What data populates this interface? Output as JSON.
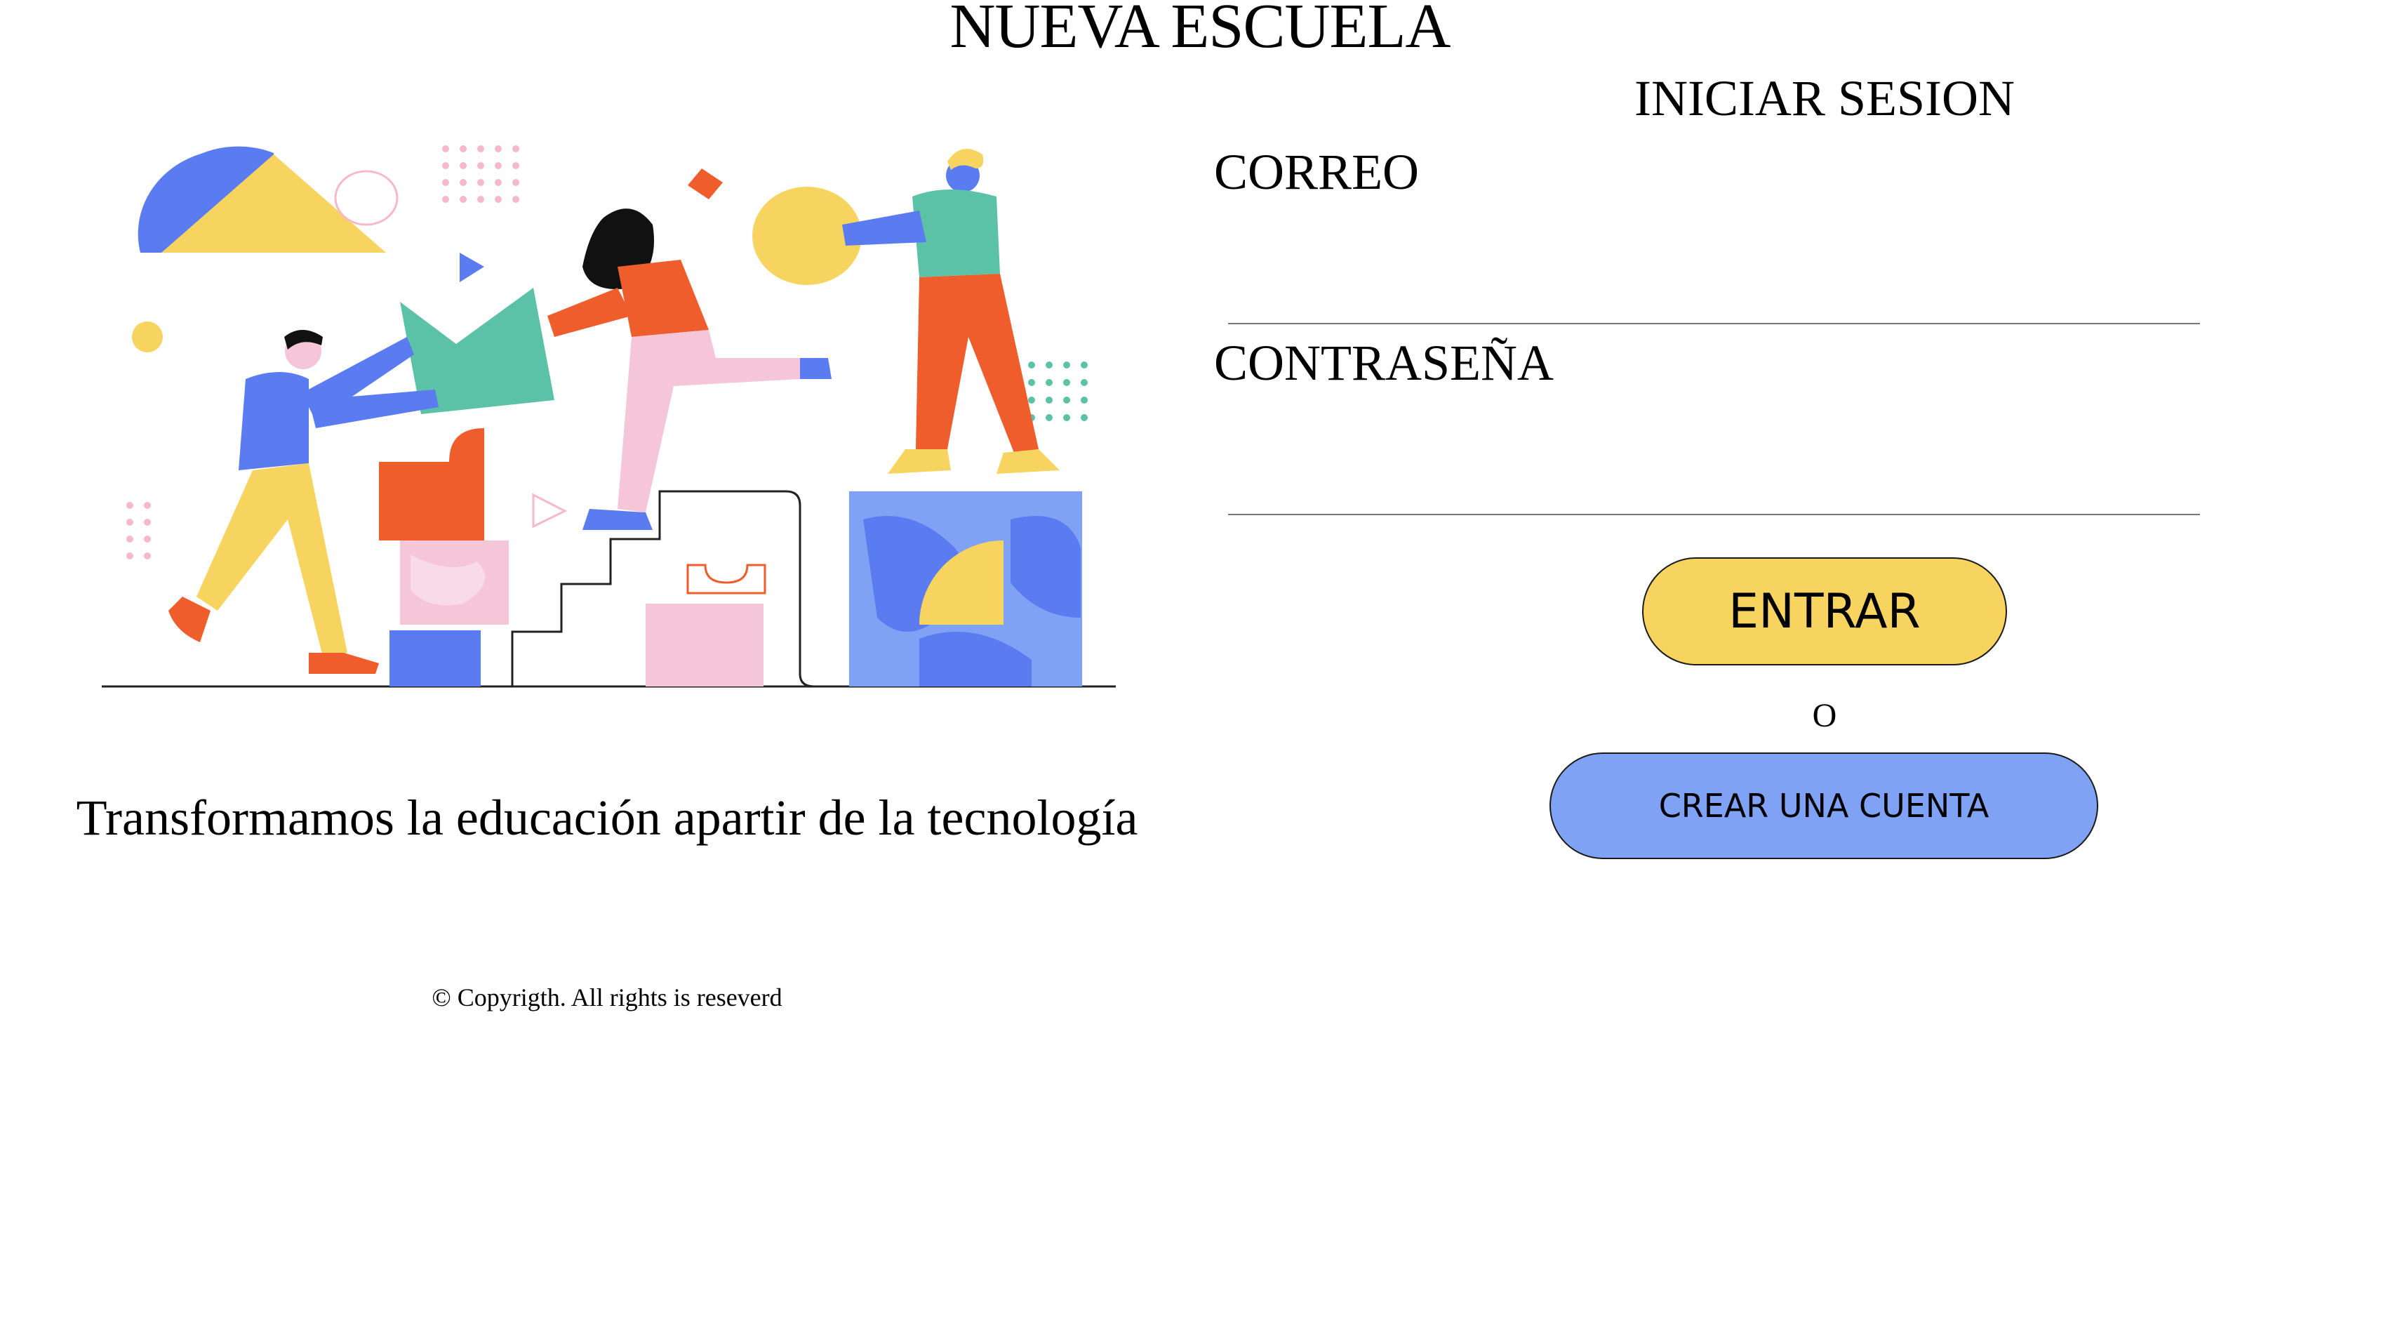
{
  "header": {
    "title": "NUEVA ESCUELA"
  },
  "hero": {
    "illustration_icon": "team-building-blocks-illustration-icon",
    "tagline": "Transformamos la educación apartir de la tecnología"
  },
  "footer": {
    "copyright": "© Copyrigth. All rights is reseverd"
  },
  "login": {
    "heading": "INICIAR SESION",
    "email_label": "CORREO",
    "email_value": "",
    "password_label": "CONTRASEÑA",
    "password_value": "",
    "submit_label": "ENTRAR",
    "separator": "O",
    "create_account_label": "CREAR UNA CUENTA"
  },
  "colors": {
    "submit_button": "#f7d45f",
    "create_account_button": "#7fa2f5",
    "illustration_blue": "#5b7cf0",
    "illustration_yellow": "#f7d45f",
    "illustration_orange": "#ef5d2d",
    "illustration_teal": "#5cc2a7",
    "illustration_pink": "#f5c6d8"
  }
}
